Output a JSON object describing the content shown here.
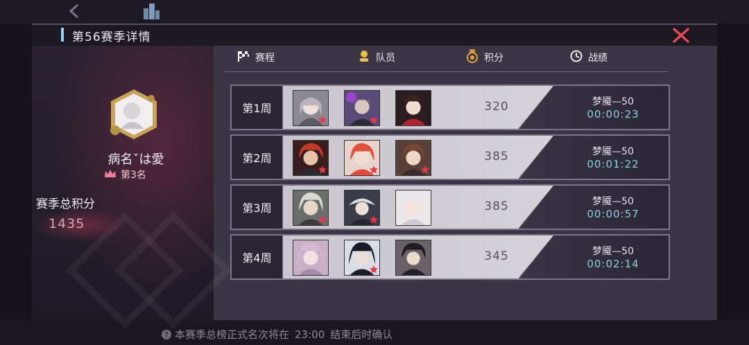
{
  "header": {
    "title": "第56赛季详情"
  },
  "nav": {
    "back_icon": "chevron-left-icon",
    "city_icon": "building-icon",
    "close_icon": "close-x-icon"
  },
  "player": {
    "name": "病名ˇは愛",
    "rank_label": "第3名",
    "total_label": "赛季总积分",
    "total_value": "1435"
  },
  "tabs": [
    {
      "label": "赛程",
      "icon": "checkered-flag-icon"
    },
    {
      "label": "队员",
      "icon": "member-icon"
    },
    {
      "label": "积分",
      "icon": "medal-icon"
    },
    {
      "label": "战绩",
      "icon": "clock-icon"
    }
  ],
  "weeks": [
    {
      "label": "第1周",
      "score": "320",
      "difficulty": "梦魇—50",
      "time": "00:00:23"
    },
    {
      "label": "第2周",
      "score": "385",
      "difficulty": "梦魇—50",
      "time": "00:01:22"
    },
    {
      "label": "第3周",
      "score": "385",
      "difficulty": "梦魇—50",
      "time": "00:00:57"
    },
    {
      "label": "第4周",
      "score": "345",
      "difficulty": "梦魇—50",
      "time": "00:02:14"
    }
  ],
  "footer": {
    "note": "本赛季总榜正式名次将在",
    "note_time": "23:00",
    "note_end": "结束后时确认"
  },
  "colors": {
    "accent_cyan": "#8fd3ee",
    "close_red": "#e84a5a",
    "time_cyan": "#89d0dc"
  }
}
